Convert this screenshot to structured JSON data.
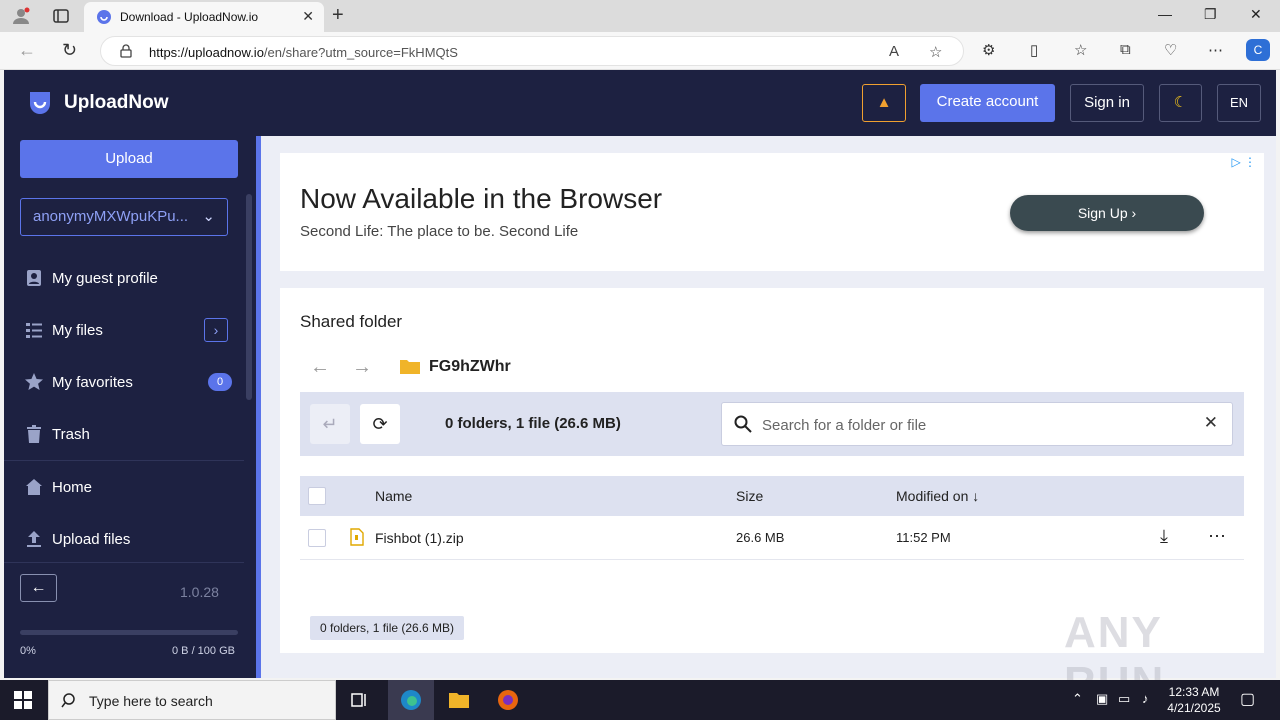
{
  "browser": {
    "tab_title": "Download - UploadNow.io",
    "url_host": "https://uploadnow.io",
    "url_path": "/en/share?utm_source=FkHMQtS"
  },
  "header": {
    "app_name": "UploadNow",
    "create_account": "Create account",
    "sign_in": "Sign in",
    "language": "EN"
  },
  "sidebar": {
    "upload": "Upload",
    "account": "anonymyMXWpuKPu...",
    "items": [
      {
        "label": "My guest profile"
      },
      {
        "label": "My files"
      },
      {
        "label": "My favorites",
        "badge": "0"
      },
      {
        "label": "Trash"
      },
      {
        "label": "Home"
      },
      {
        "label": "Upload files"
      }
    ],
    "version": "1.0.28",
    "storage_fraction": 0,
    "storage_pct": "0%",
    "storage_amount": "0 B / 100 GB"
  },
  "ad": {
    "headline": "Now Available in the Browser",
    "subline": "Second Life: The place to be. Second Life",
    "cta": "Sign Up"
  },
  "folder": {
    "title": "Shared folder",
    "name": "FG9hZWhr",
    "count": "0 folders, 1 file (26.6 MB)",
    "search_placeholder": "Search for a folder or file",
    "columns": {
      "name": "Name",
      "size": "Size",
      "modified": "Modified on"
    },
    "files": [
      {
        "name": "Fishbot (1).zip",
        "size": "26.6 MB",
        "modified": "11:52 PM"
      }
    ],
    "summary": "0 folders, 1 file (26.6 MB)"
  },
  "watermark": "ANY RUN",
  "taskbar": {
    "search_placeholder": "Type here to search",
    "time": "12:33 AM",
    "date": "4/21/2025"
  },
  "colors": {
    "accent": "#5b74ea",
    "sidebar_bg": "#1d2141",
    "warning": "#f0a030"
  }
}
